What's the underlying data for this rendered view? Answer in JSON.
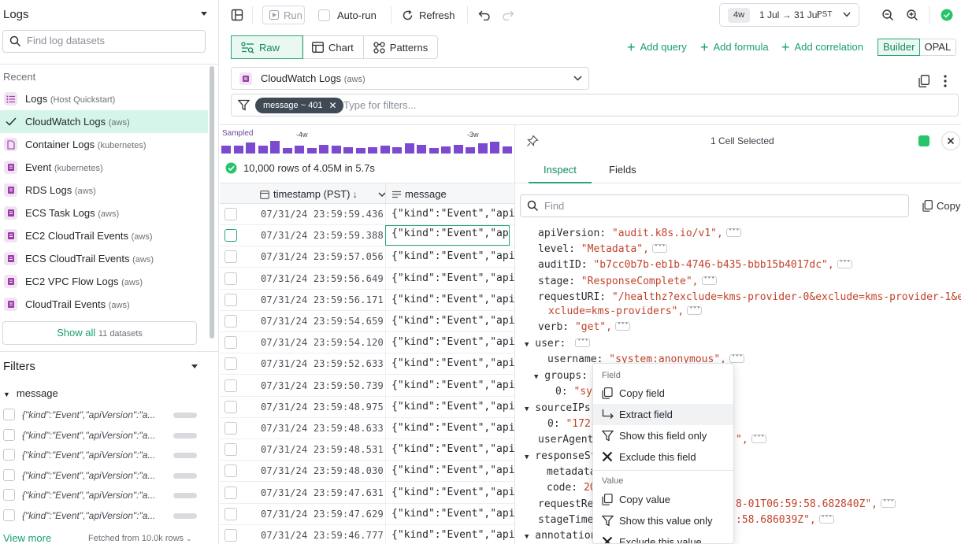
{
  "sidebar": {
    "title": "Logs",
    "search_placeholder": "Find log datasets",
    "recent_label": "Recent",
    "datasets": [
      {
        "name": "Logs",
        "sub": "(Host Quickstart)",
        "icon": "list-icon"
      },
      {
        "name": "CloudWatch Logs",
        "sub": "(aws)",
        "icon": "check-icon",
        "active": true
      },
      {
        "name": "Container Logs",
        "sub": "(kubernetes)",
        "icon": "file-icon"
      },
      {
        "name": "Event",
        "sub": "(kubernetes)",
        "icon": "dataset-icon"
      },
      {
        "name": "RDS Logs",
        "sub": "(aws)",
        "icon": "dataset-icon"
      },
      {
        "name": "ECS Task Logs",
        "sub": "(aws)",
        "icon": "dataset-icon"
      },
      {
        "name": "EC2 CloudTrail Events",
        "sub": "(aws)",
        "icon": "dataset-icon"
      },
      {
        "name": "ECS CloudTrail Events",
        "sub": "(aws)",
        "icon": "dataset-icon"
      },
      {
        "name": "EC2 VPC Flow Logs",
        "sub": "(aws)",
        "icon": "dataset-icon"
      },
      {
        "name": "CloudTrail Events",
        "sub": "(aws)",
        "icon": "dataset-icon"
      }
    ],
    "show_all_label": "Show all",
    "show_all_count": "11 datasets",
    "filters_title": "Filters",
    "filter_field": "message",
    "filter_values": [
      "{\"kind\":\"Event\",\"apiVersion\":\"a...",
      "{\"kind\":\"Event\",\"apiVersion\":\"a...",
      "{\"kind\":\"Event\",\"apiVersion\":\"a...",
      "{\"kind\":\"Event\",\"apiVersion\":\"a...",
      "{\"kind\":\"Event\",\"apiVersion\":\"a...",
      "{\"kind\":\"Event\",\"apiVersion\":\"a..."
    ],
    "view_more": "View more",
    "fetched": "Fetched from 10.0k rows"
  },
  "toolbar": {
    "run": "Run",
    "autorun": "Auto-run",
    "refresh": "Refresh",
    "range_chip": "4w",
    "range_dates": "1 Jul → 31 Jul",
    "timezone": "PST",
    "status_color": "#27c46b"
  },
  "modes": {
    "raw": "Raw",
    "chart": "Chart",
    "patterns": "Patterns",
    "add_query": "Add query",
    "add_formula": "Add formula",
    "add_correlation": "Add correlation",
    "builder": "Builder",
    "opal": "OPAL"
  },
  "query": {
    "dataset": "CloudWatch Logs",
    "dataset_sub": "(aws)",
    "filter_chip": "message ~ 401",
    "filter_placeholder": "Type for filters..."
  },
  "histogram": {
    "label": "Sampled",
    "ticks": [
      "-4w",
      "-3w"
    ],
    "bar_levels": [
      0.55,
      0.55,
      0.75,
      0.55,
      0.9,
      0.4,
      0.55,
      0.4,
      0.6,
      0.55,
      0.45,
      0.4,
      0.45,
      0.55,
      0.45,
      0.7,
      0.6,
      0.4,
      0.5,
      0.6,
      0.45,
      0.7,
      0.85,
      0.5,
      0.2
    ],
    "color": "#7c4ad1"
  },
  "results": {
    "summary": "10,000 rows of 4.05M in 5.7s",
    "col_timestamp": "timestamp (PST)",
    "col_message": "message",
    "rows": [
      {
        "ts": "07/31/24 23:59:59.436",
        "msg": "{\"kind\":\"Event\",\"apiVersion\""
      },
      {
        "ts": "07/31/24 23:59:59.388",
        "msg": "{\"kind\":\"Event\",\"apiVersion\"",
        "selected": true
      },
      {
        "ts": "07/31/24 23:59:57.056",
        "msg": "{\"kind\":\"Event\",\"apiVersion\""
      },
      {
        "ts": "07/31/24 23:59:56.649",
        "msg": "{\"kind\":\"Event\",\"apiVersion\""
      },
      {
        "ts": "07/31/24 23:59:56.171",
        "msg": "{\"kind\":\"Event\",\"apiVersion\""
      },
      {
        "ts": "07/31/24 23:59:54.659",
        "msg": "{\"kind\":\"Event\",\"apiVersion\""
      },
      {
        "ts": "07/31/24 23:59:54.120",
        "msg": "{\"kind\":\"Event\",\"apiVersion\""
      },
      {
        "ts": "07/31/24 23:59:52.633",
        "msg": "{\"kind\":\"Event\",\"apiVersion\""
      },
      {
        "ts": "07/31/24 23:59:50.739",
        "msg": "{\"kind\":\"Event\",\"apiVersion\""
      },
      {
        "ts": "07/31/24 23:59:48.975",
        "msg": "{\"kind\":\"Event\",\"apiVersion\""
      },
      {
        "ts": "07/31/24 23:59:48.633",
        "msg": "{\"kind\":\"Event\",\"apiVersion\""
      },
      {
        "ts": "07/31/24 23:59:48.531",
        "msg": "{\"kind\":\"Event\",\"apiVersion\""
      },
      {
        "ts": "07/31/24 23:59:48.030",
        "msg": "{\"kind\":\"Event\",\"apiVersion\""
      },
      {
        "ts": "07/31/24 23:59:47.631",
        "msg": "{\"kind\":\"Event\",\"apiVersion\""
      },
      {
        "ts": "07/31/24 23:59:47.629",
        "msg": "{\"kind\":\"Event\",\"apiVersion\""
      },
      {
        "ts": "07/31/24 23:59:46.777",
        "msg": "{\"kind\":\"Event\",\"apiVersion\""
      }
    ]
  },
  "panel": {
    "title": "1 Cell Selected",
    "status_color": "#27c46b",
    "tab_inspect": "Inspect",
    "tab_fields": "Fields",
    "find_placeholder": "Find",
    "copy": "Copy",
    "json": {
      "apiVersion_key": "apiVersion:",
      "apiVersion_val": "\"audit.k8s.io/v1\",",
      "level_key": "level:",
      "level_val": "\"Metadata\",",
      "auditID_key": "auditID:",
      "auditID_val": "\"b7cc0b7b-eb1b-4746-b435-bbb15b4017dc\",",
      "stage_key": "stage:",
      "stage_val": "\"ResponseComplete\",",
      "requestURI_key": "requestURI:",
      "requestURI_val1": "\"/healthz?exclude=kms-provider-0&exclude=kms-provider-1&e",
      "requestURI_val2": "xclude=kms-providers\",",
      "verb_key": "verb:",
      "verb_val": "\"get\",",
      "user_key": "user:",
      "username_key": "username:",
      "username_val": "\"system:anonymous\",",
      "groups_key": "groups:",
      "groups_idx": "0:",
      "groups_val": "\"sys",
      "sourceIPs_key": "sourceIPs",
      "sourceIPs_idx": "0:",
      "sourceIPs_val": "\"172.",
      "userAgent_key": "userAgent",
      "userAgent_tail": "\",",
      "responseStatus_key": "responseSt",
      "metadata_key": "metadata",
      "code_key": "code:",
      "code_val": "20",
      "requestReceived_key": "requestRe",
      "requestReceived_val": "8-01T06:59:58.682840Z\",",
      "stageTimestamp_key": "stageTime",
      "stageTimestamp_val": ":58.686039Z\",",
      "annotations_key": "annotation"
    }
  },
  "context_menu": {
    "field_section": "Field",
    "copy_field": "Copy field",
    "extract_field": "Extract field",
    "show_field_only": "Show this field only",
    "exclude_field": "Exclude this field",
    "value_section": "Value",
    "copy_value": "Copy value",
    "show_value_only": "Show this value only",
    "exclude_value": "Exclude this value"
  }
}
